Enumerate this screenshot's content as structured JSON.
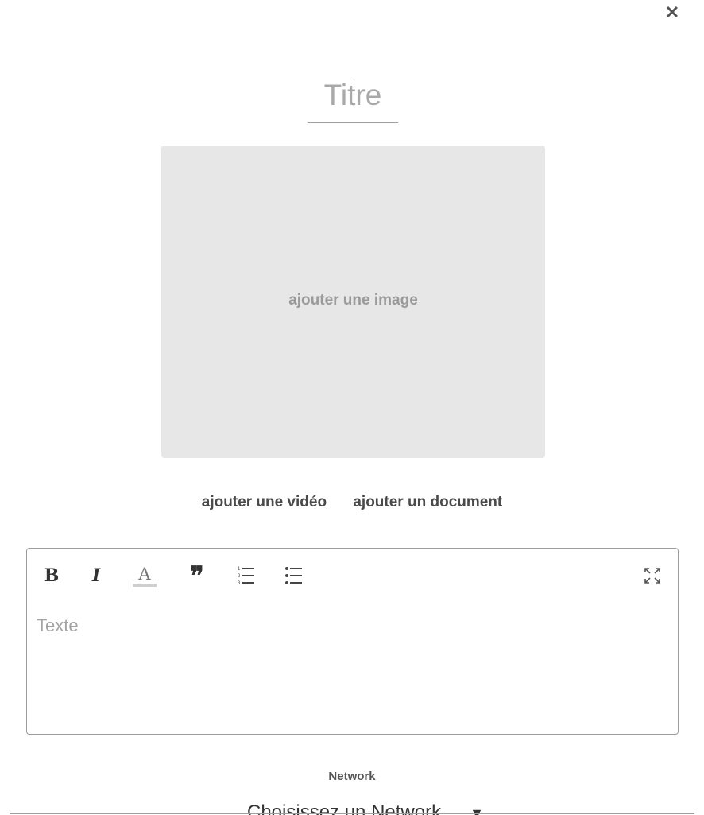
{
  "close": {
    "icon": "close-icon",
    "glyph": "✕"
  },
  "title": {
    "placeholder": "Titre",
    "value": ""
  },
  "image_upload": {
    "label": "ajouter une image"
  },
  "media_links": {
    "video_label": "ajouter une vidéo",
    "document_label": "ajouter un document"
  },
  "editor": {
    "toolbar": {
      "bold": "B",
      "italic": "I",
      "text_color": "A",
      "quote": "❞",
      "ordered_list_icon": "ordered-list-icon",
      "unordered_list_icon": "unordered-list-icon",
      "fullscreen_icon": "fullscreen-icon"
    },
    "placeholder": "Texte"
  },
  "network": {
    "label": "Network",
    "selected": "Choisissez un Network",
    "arrow": "▼"
  },
  "colors": {
    "image_bg": "#e7e7e7",
    "border": "#9c9c9c",
    "placeholder_text": "#a3a3a3"
  }
}
